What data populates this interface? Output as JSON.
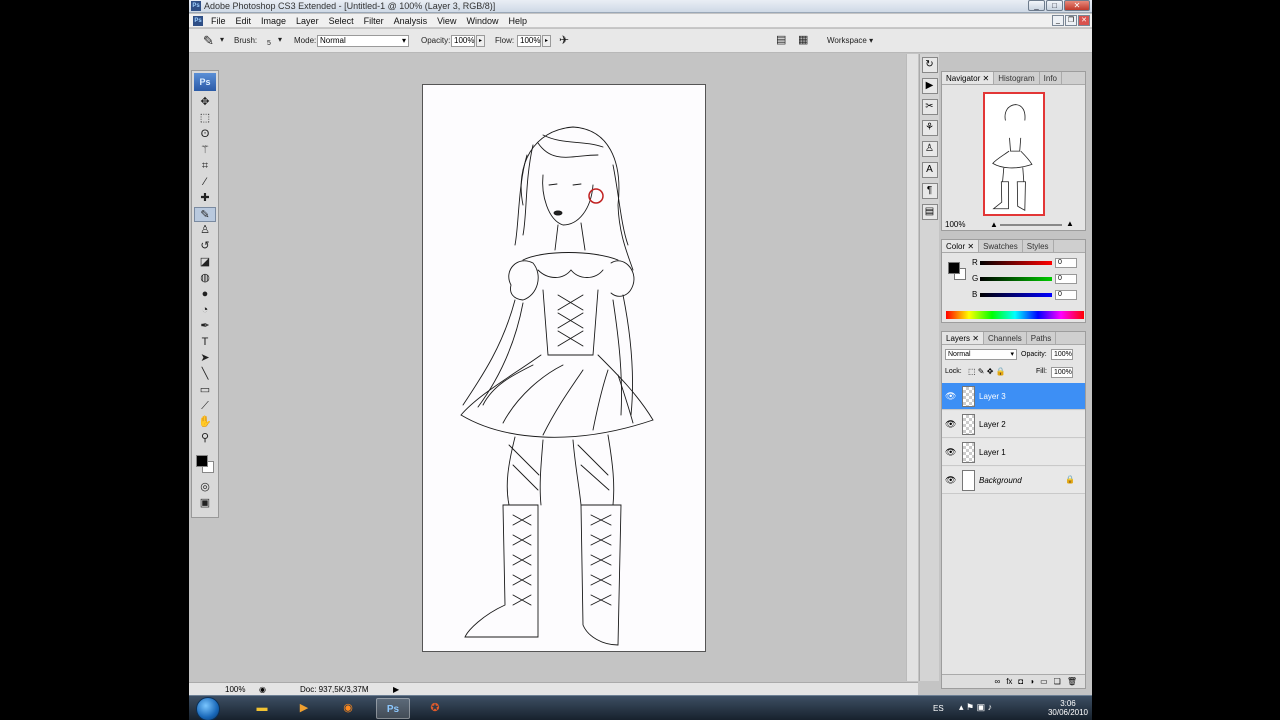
{
  "window": {
    "title": "Adobe Photoshop CS3 Extended - [Untitled-1 @ 100% (Layer 3, RGB/8)]",
    "app_icon": "Ps"
  },
  "menu": [
    "File",
    "Edit",
    "Image",
    "Layer",
    "Select",
    "Filter",
    "Analysis",
    "View",
    "Window",
    "Help"
  ],
  "options_bar": {
    "brush_label": "Brush:",
    "brush_size": "5",
    "mode_label": "Mode:",
    "mode_value": "Normal",
    "opacity_label": "Opacity:",
    "opacity_value": "100%",
    "flow_label": "Flow:",
    "flow_value": "100%",
    "workspace_label": "Workspace"
  },
  "toolbox": {
    "logo": "Ps",
    "tools": [
      "move-tool",
      "marquee-tool",
      "lasso-tool",
      "magic-wand-tool",
      "crop-tool",
      "slice-tool",
      "healing-brush-tool",
      "brush-tool",
      "clone-stamp-tool",
      "history-brush-tool",
      "eraser-tool",
      "paint-bucket-tool",
      "blur-tool",
      "dodge-tool",
      "pen-tool",
      "type-tool",
      "path-selection-tool",
      "line-tool",
      "notes-tool",
      "eyedropper-tool",
      "hand-tool",
      "zoom-tool"
    ],
    "selected_tool": "brush-tool"
  },
  "status": {
    "zoom": "100%",
    "doc": "Doc: 937,5K/3,37M"
  },
  "navigator": {
    "tabs": [
      "Navigator",
      "Histogram",
      "Info"
    ],
    "zoom": "100%"
  },
  "color_panel": {
    "tabs": [
      "Color",
      "Swatches",
      "Styles"
    ],
    "channels": [
      {
        "label": "R",
        "value": "0",
        "color": "#e02020"
      },
      {
        "label": "G",
        "value": "0",
        "color": "#20b020"
      },
      {
        "label": "B",
        "value": "0",
        "color": "#2040e0"
      }
    ]
  },
  "layers_panel": {
    "tabs": [
      "Layers",
      "Channels",
      "Paths"
    ],
    "blend_mode": "Normal",
    "opacity_label": "Opacity:",
    "opacity_value": "100%",
    "lock_label": "Lock:",
    "fill_label": "Fill:",
    "fill_value": "100%",
    "layers": [
      {
        "name": "Layer 3",
        "selected": true
      },
      {
        "name": "Layer 2",
        "selected": false
      },
      {
        "name": "Layer 1",
        "selected": false
      },
      {
        "name": "Background",
        "selected": false,
        "locked": true
      }
    ]
  },
  "taskbar": {
    "language": "ES",
    "time": "3:06",
    "date": "30/06/2010",
    "apps": [
      "explorer",
      "media-player",
      "firefox",
      "photoshop",
      "media-center"
    ]
  }
}
